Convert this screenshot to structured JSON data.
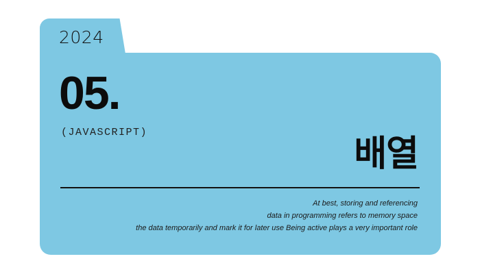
{
  "card": {
    "year": "2024",
    "chapter_number": "05.",
    "subject_tag": "(JAVASCRIPT)",
    "topic_title": "배열",
    "description_lines": [
      "At best, storing and referencing",
      "data in programming refers to memory space",
      "the data temporarily and mark it for later use Being active plays a very important role"
    ]
  },
  "colors": {
    "folder": "#7ec8e3",
    "text": "#111111",
    "background": "#ffffff"
  }
}
